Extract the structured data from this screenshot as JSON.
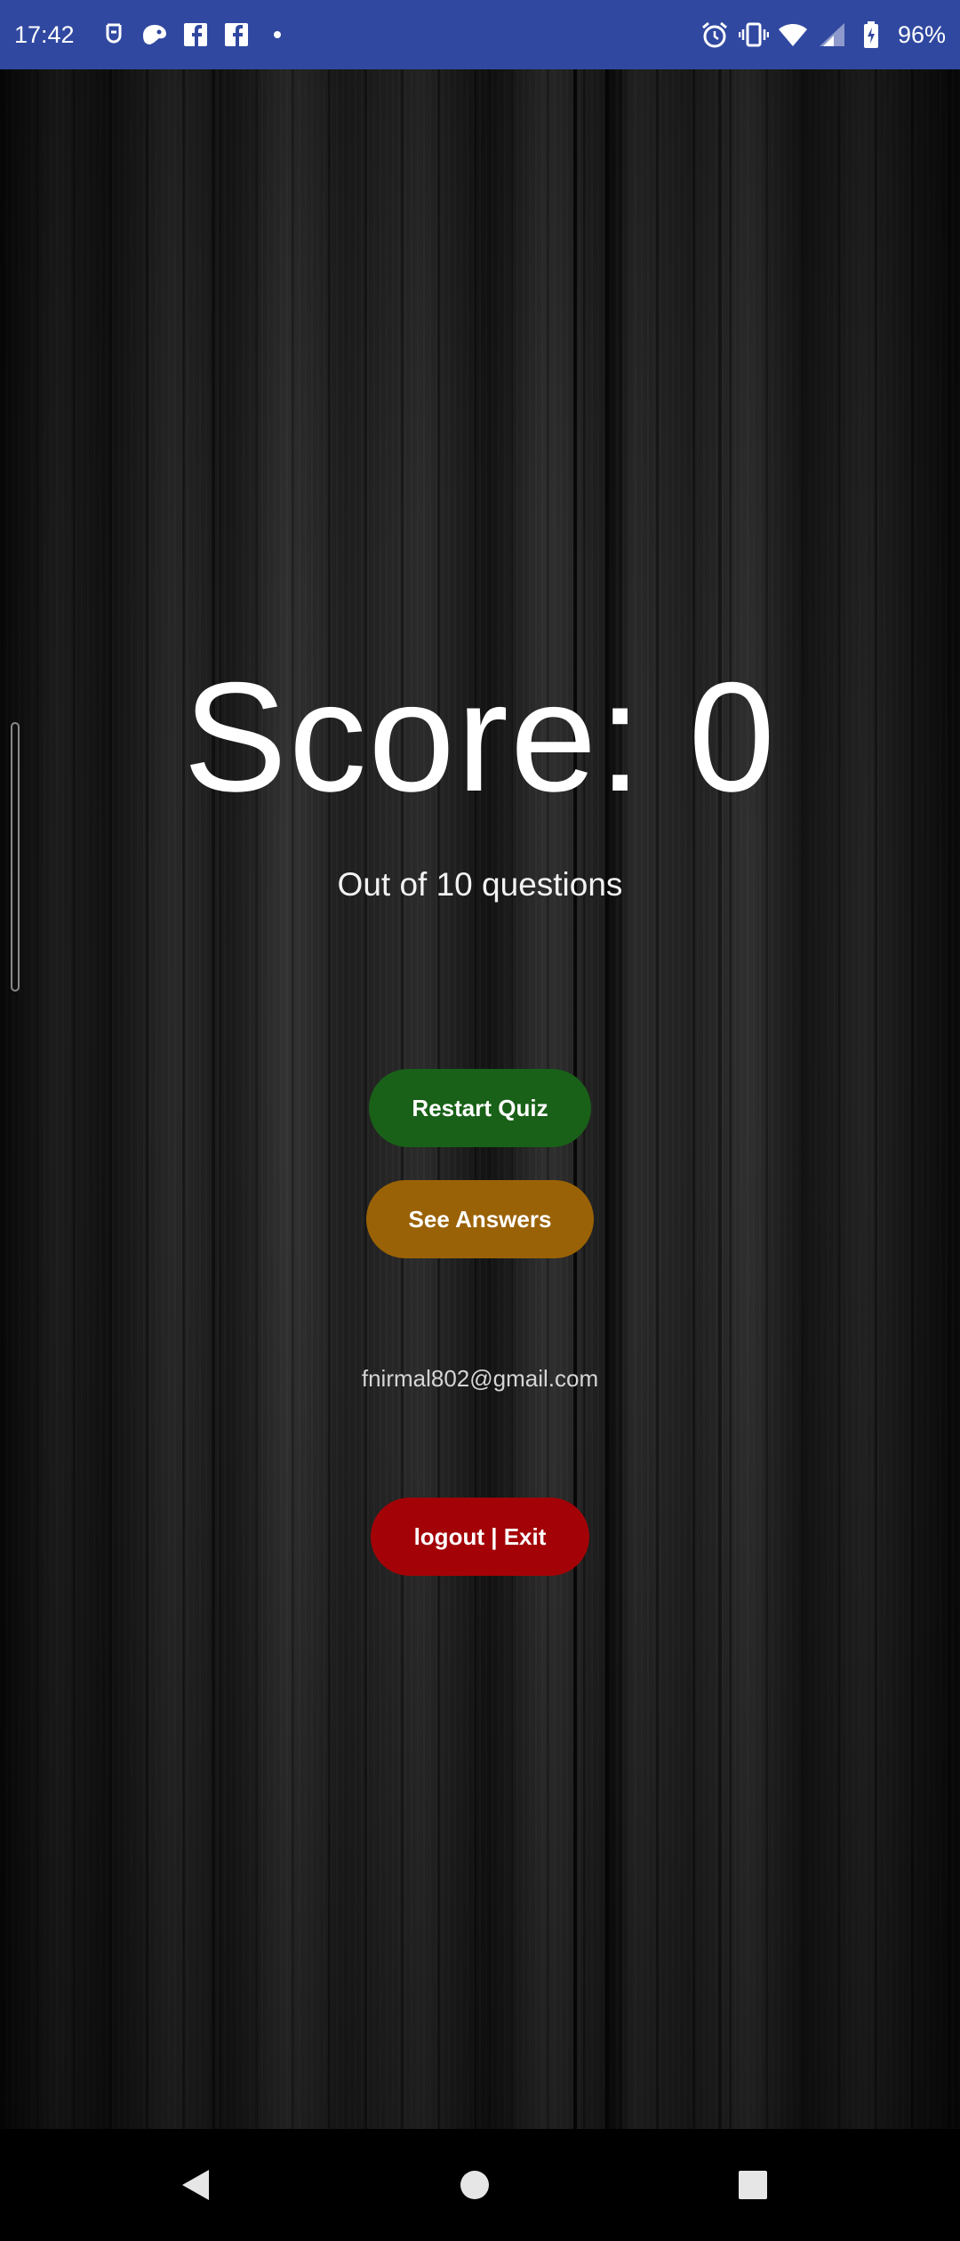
{
  "status_bar": {
    "time": "17:42",
    "battery": "96%",
    "left_icons": [
      "usb-debug-icon",
      "game-controller-icon",
      "facebook-icon",
      "facebook-icon",
      "more-dot-icon"
    ],
    "right_icons": [
      "alarm-icon",
      "vibrate-icon",
      "wifi-icon",
      "signal-icon",
      "battery-charging-icon"
    ],
    "bar_color": "#3048a0"
  },
  "result": {
    "score_text": "Score: 0",
    "subtitle": "Out of 10 questions"
  },
  "buttons": {
    "restart_label": "Restart Quiz",
    "answers_label": "See Answers",
    "logout_label": "logout | Exit"
  },
  "colors": {
    "restart": "#196118",
    "answers": "#9a6206",
    "logout": "#a30307"
  },
  "user": {
    "email": "fnirmal802@gmail.com"
  },
  "nav": {
    "icons": [
      "back-icon",
      "home-icon",
      "recents-icon"
    ]
  }
}
